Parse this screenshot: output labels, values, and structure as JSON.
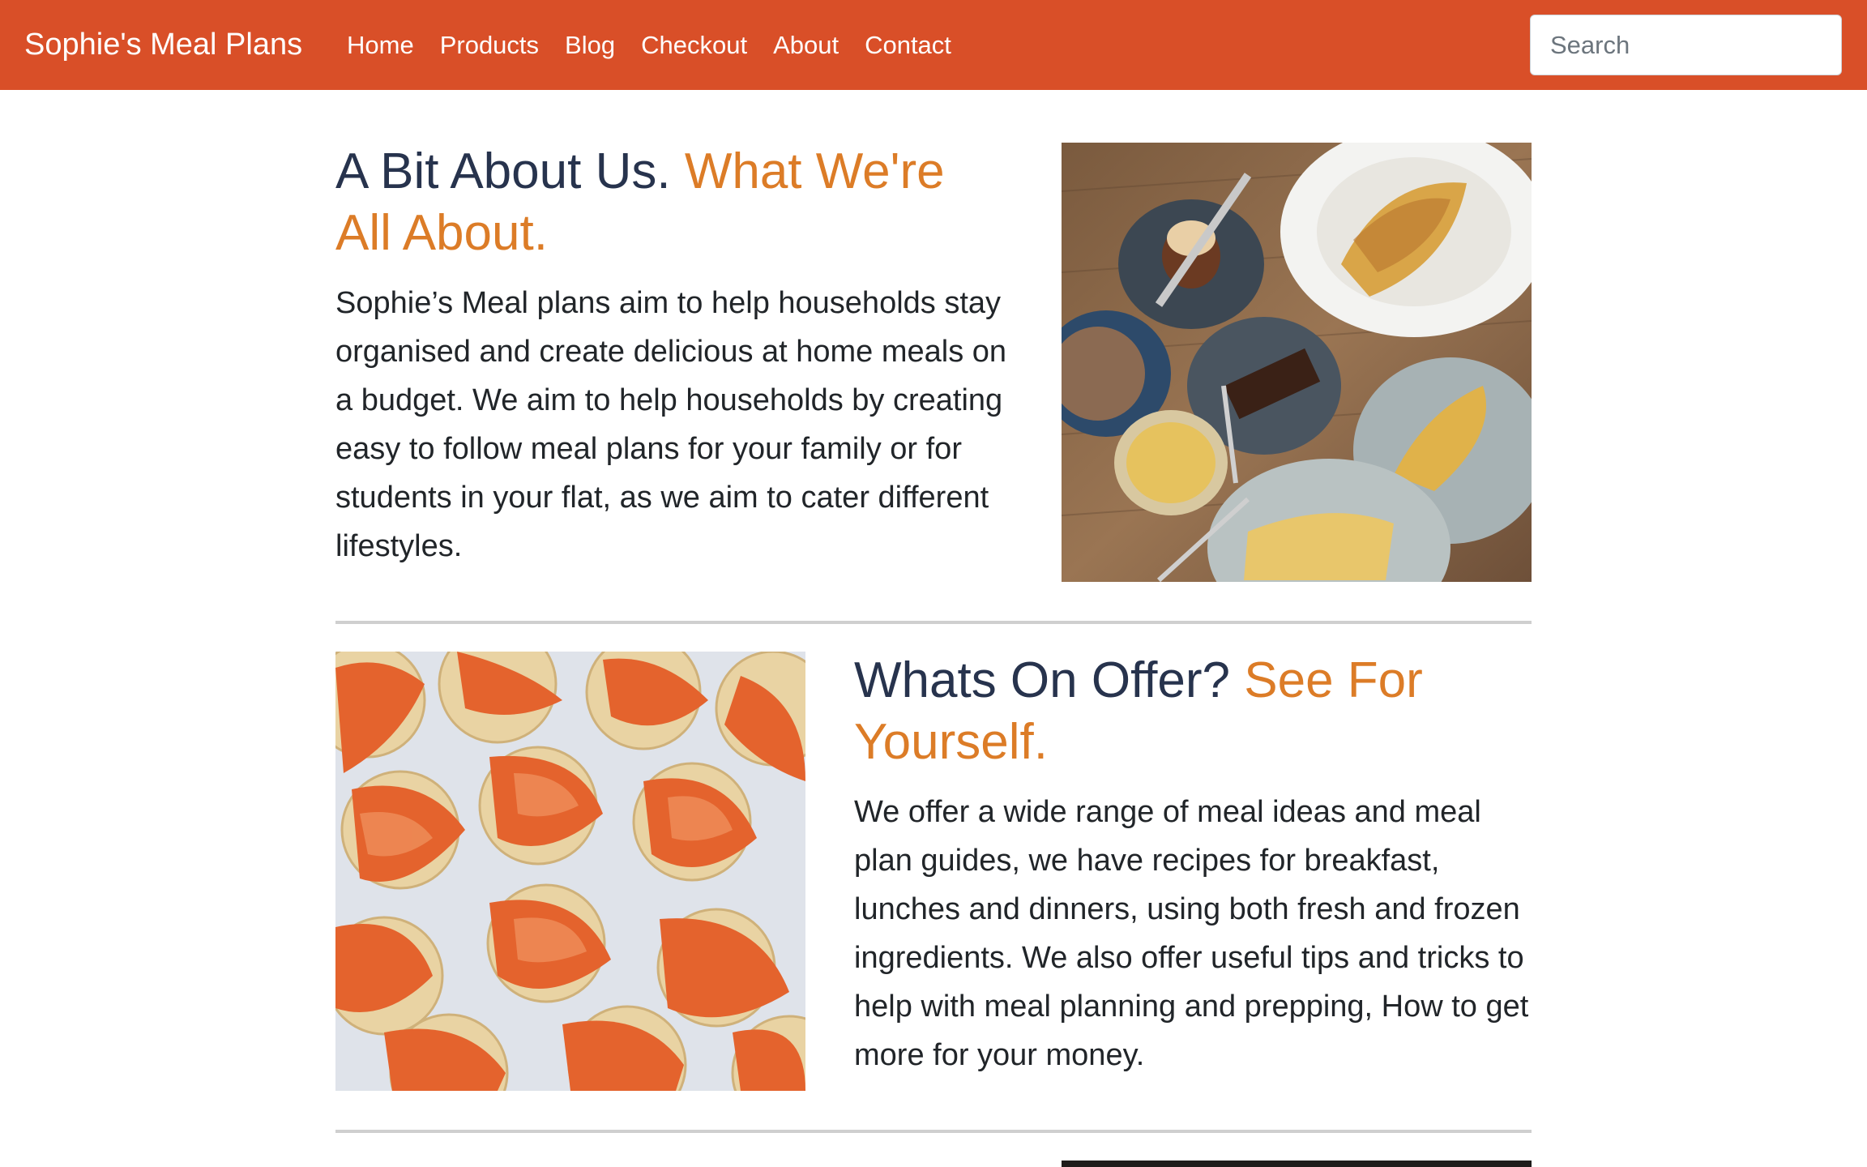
{
  "navbar": {
    "brand": "Sophie's Meal Plans",
    "links": [
      "Home",
      "Products",
      "Blog",
      "Checkout",
      "About",
      "Contact"
    ],
    "search_placeholder": "Search"
  },
  "sections": [
    {
      "heading_main": "A Bit About Us.",
      "heading_accent": "What We're All About.",
      "text": "Sophie’s Meal plans aim to help households stay organised and create delicious at home meals on a budget. We aim to help households by creating easy to follow meal plans for your family or for students in your flat, as we aim to cater different lifestyles."
    },
    {
      "heading_main": "Whats On Offer?",
      "heading_accent": "See For Yourself.",
      "text": "We offer a wide range of meal ideas and meal plan guides, we have recipes for breakfast, lunches and dinners, using both fresh and frozen ingredients. We also offer useful tips and tricks to help with meal planning and prepping, How to get more for your money."
    }
  ],
  "colors": {
    "navbar": "#d94f28",
    "heading": "#27334d",
    "accent": "#dc7c27",
    "divider": "#cfcfcf"
  }
}
